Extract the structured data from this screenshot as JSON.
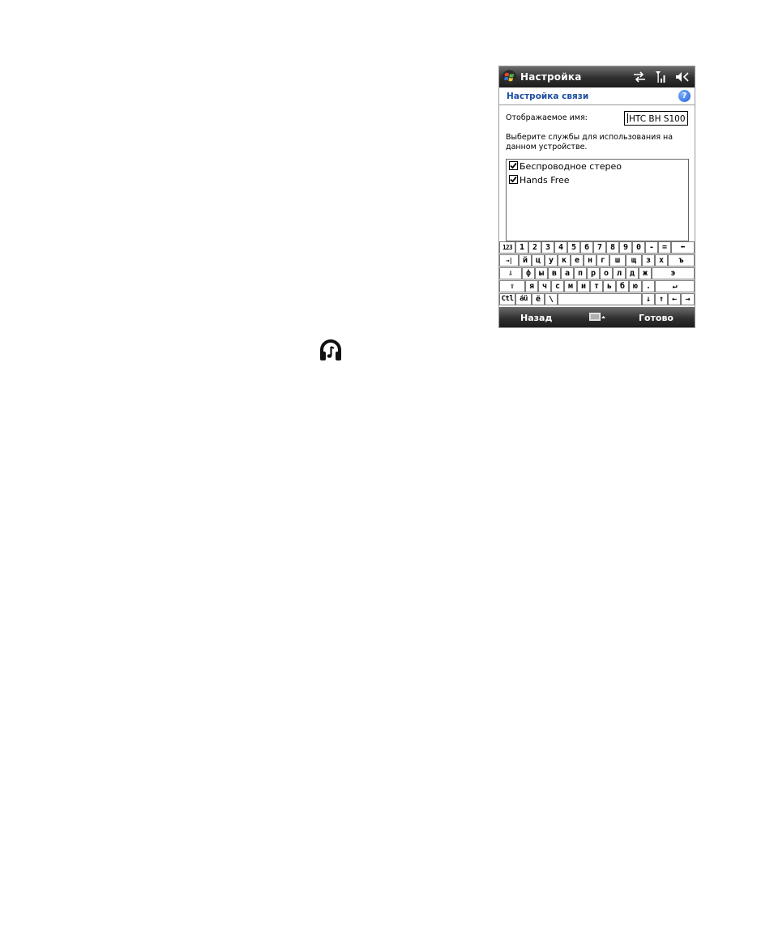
{
  "titlebar": {
    "title": "Настройка",
    "icons": [
      "start-logo-icon",
      "sync-arrows-icon",
      "signal-icon",
      "speaker-muted-icon"
    ]
  },
  "header": {
    "title": "Настройка связи",
    "help_icon": "help-icon"
  },
  "form": {
    "display_name_label": "Отображаемое имя:",
    "display_name_value": "HTC BH S100",
    "services_prompt": "Выберите службы для использования на данном устройстве.",
    "services": [
      {
        "label": "Беспроводное стерео",
        "checked": true
      },
      {
        "label": "Hands Free",
        "checked": true
      }
    ]
  },
  "keyboard": {
    "rows": [
      [
        "123",
        "1",
        "2",
        "3",
        "4",
        "5",
        "6",
        "7",
        "8",
        "9",
        "0",
        "-",
        "=",
        "⬅"
      ],
      [
        "→|",
        "й",
        "ц",
        "у",
        "к",
        "е",
        "н",
        "г",
        "ш",
        "щ",
        "з",
        "х",
        "ъ"
      ],
      [
        "⇩",
        "ф",
        "ы",
        "в",
        "а",
        "п",
        "р",
        "о",
        "л",
        "д",
        "ж",
        "э"
      ],
      [
        "⇧",
        "я",
        "ч",
        "с",
        "м",
        "и",
        "т",
        "ь",
        "б",
        "ю",
        ".",
        "↵"
      ],
      [
        "Ctl",
        "áü",
        "ë",
        "\\",
        " ",
        "↓",
        "↑",
        "←",
        "→"
      ]
    ]
  },
  "softkeys": {
    "left": "Назад",
    "right": "Готово",
    "center_icon": "keyboard-icon"
  },
  "page_icon": "headset-icon"
}
